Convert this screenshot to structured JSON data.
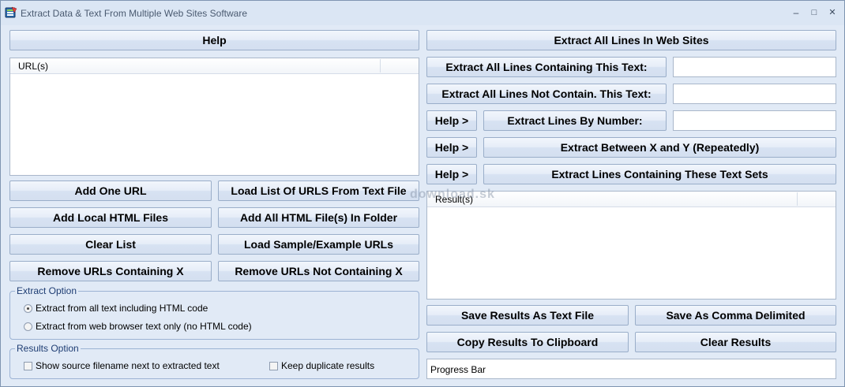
{
  "window": {
    "title": "Extract Data & Text From Multiple Web Sites Software",
    "minimize": "–",
    "maximize": "□",
    "close": "✕"
  },
  "left": {
    "help_label": "Help",
    "url_list_header": "URL(s)",
    "buttons": {
      "add_one_url": "Add One URL",
      "load_list": "Load List Of URLS From Text File",
      "add_local_html": "Add Local HTML Files",
      "add_all_html_folder": "Add All HTML File(s) In Folder",
      "clear_list": "Clear List",
      "load_sample": "Load Sample/Example URLs",
      "remove_containing": "Remove URLs Containing X",
      "remove_not_containing": "Remove URLs Not Containing X"
    },
    "extract_option": {
      "title": "Extract Option",
      "options": [
        "Extract from all text including HTML code",
        "Extract from web browser text only (no HTML code)"
      ],
      "selected_index": 0
    },
    "results_option": {
      "title": "Results Option",
      "show_source": "Show source filename next to extracted text",
      "keep_duplicates": "Keep duplicate results",
      "show_source_checked": false,
      "keep_duplicates_checked": false
    }
  },
  "right": {
    "extract_all_lines": "Extract All Lines In Web Sites",
    "extract_containing": "Extract All Lines Containing This Text:",
    "extract_not_containing": "Extract All Lines Not Contain. This Text:",
    "help_small": "Help >",
    "extract_by_number": "Extract Lines By Number:",
    "extract_between": "Extract Between X and Y (Repeatedly)",
    "extract_text_sets": "Extract Lines Containing These Text Sets",
    "containing_value": "",
    "not_containing_value": "",
    "line_number_value": "",
    "results_header": "Result(s)",
    "save_text": "Save Results As Text File",
    "save_comma": "Save As Comma Delimited",
    "copy_clipboard": "Copy Results To Clipboard",
    "clear_results": "Clear Results",
    "progress": "Progress Bar"
  },
  "watermark": "download.sk",
  "colors": {
    "background": "#e1eaf6",
    "button_border": "#9aaec9",
    "group_title": "#1e3d73"
  }
}
